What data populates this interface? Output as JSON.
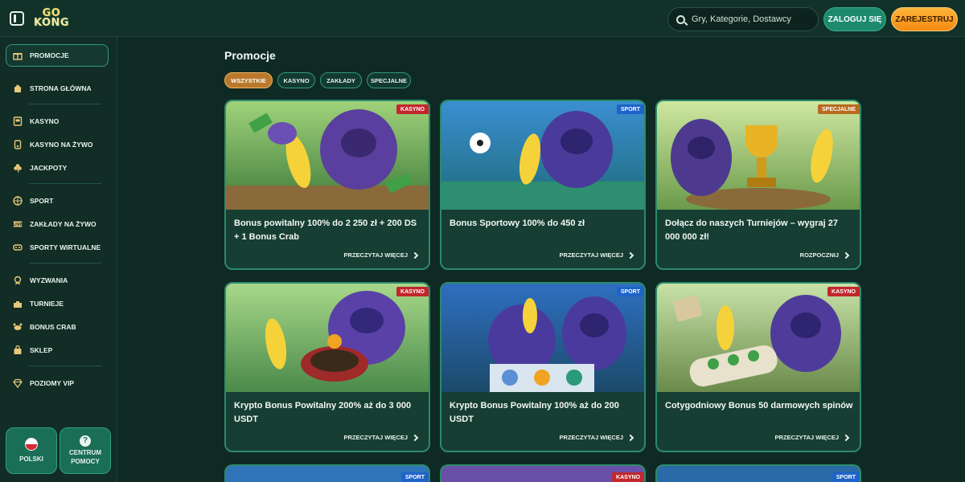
{
  "header": {
    "logo_line1": "GO",
    "logo_line2": "KONG",
    "search_placeholder": "Gry, Kategorie, Dostawcy",
    "login_label": "ZALOGUJ SIĘ",
    "register_label": "ZAREJESTRUJ"
  },
  "sidebar": {
    "active_label": "PROMOCJE",
    "items": [
      {
        "label": "STRONA GŁÓWNA",
        "icon": "home-icon"
      },
      {
        "label": "KASYNO",
        "icon": "slot-machine-icon"
      },
      {
        "label": "KASYNO NA ŻYWO",
        "icon": "live-casino-icon"
      },
      {
        "label": "JACKPOTY",
        "icon": "clover-icon"
      },
      {
        "label": "SPORT",
        "icon": "ball-icon"
      },
      {
        "label": "ZAKŁADY NA ŻYWO",
        "icon": "live-bets-icon"
      },
      {
        "label": "SPORTY WIRTUALNE",
        "icon": "virtual-sports-icon"
      },
      {
        "label": "WYZWANIA",
        "icon": "medal-icon"
      },
      {
        "label": "TURNIEJE",
        "icon": "tournament-icon"
      },
      {
        "label": "BONUS CRAB",
        "icon": "crab-icon"
      },
      {
        "label": "SKLEP",
        "icon": "shop-bag-icon"
      },
      {
        "label": "POZIOMY VIP",
        "icon": "diamond-icon"
      }
    ],
    "language_label": "POLSKI",
    "help_label_1": "CENTRUM",
    "help_label_2": "POMOCY"
  },
  "main": {
    "title": "Promocje",
    "tabs": [
      "WSZYSTKIE",
      "KASYNO",
      "ZAKŁADY",
      "SPECJALNE"
    ],
    "cards": [
      {
        "tag": "KASYNO",
        "title": "Bonus powitalny 100% do 2 250 zł + 200 DS + 1 Bonus Crab",
        "link": "PRZECZYTAJ WIĘCEJ"
      },
      {
        "tag": "SPORT",
        "title": "Bonus Sportowy 100% do 450 zł",
        "link": "PRZECZYTAJ WIĘCEJ"
      },
      {
        "tag": "SPECJALNE",
        "title": "Dołącz do naszych Turniejów – wygraj 27 000 000 zł!",
        "link": "ROZPOCZNIJ"
      },
      {
        "tag": "KASYNO",
        "title": "Krypto Bonus Powitalny 200% aż do 3 000 USDT",
        "link": "PRZECZYTAJ WIĘCEJ"
      },
      {
        "tag": "SPORT",
        "title": "Krypto Bonus Powitalny 100% aż do 200 USDT",
        "link": "PRZECZYTAJ WIĘCEJ"
      },
      {
        "tag": "KASYNO",
        "title": "Cotygodniowy Bonus 50 darmowych spinów",
        "link": "PRZECZYTAJ WIĘCEJ"
      }
    ],
    "stubs": [
      {
        "tag": "SPORT"
      },
      {
        "tag": "KASYNO"
      },
      {
        "tag": "SPORT"
      }
    ]
  },
  "colors": {
    "background": "#0f2a24",
    "accent_green": "#2c8a6b",
    "accent_orange": "#f58a12",
    "tag_kasyno": "#c1272d",
    "tag_sport": "#1e63c9",
    "tag_specjalne": "#b86a1f"
  }
}
